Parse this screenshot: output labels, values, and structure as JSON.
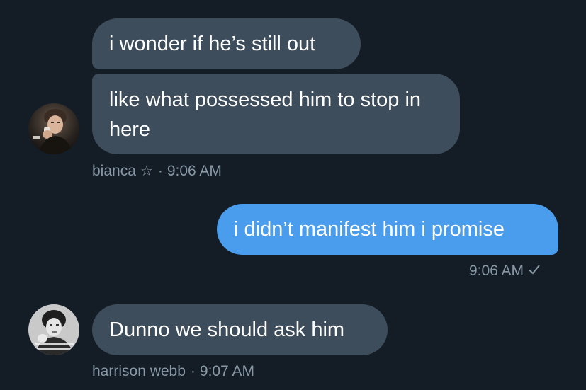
{
  "conversation": {
    "messages": [
      {
        "text": "i wonder if he’s still out"
      },
      {
        "text": "like what possessed him to stop in here"
      },
      {
        "text": "i didn’t manifest him i promise"
      },
      {
        "text": "Dunno we should ask him"
      }
    ],
    "meta": {
      "bianca": {
        "name": "bianca",
        "separator": "·",
        "time": "9:06 AM"
      },
      "self": {
        "time": "9:06 AM"
      },
      "harrison": {
        "name": "harrison webb",
        "separator": "·",
        "time": "9:07 AM"
      }
    }
  },
  "icons": {
    "star": "star-icon",
    "checkmark": "checkmark-icon",
    "avatar1": "user-avatar-photo",
    "avatar2": "user-avatar-photo"
  },
  "colors": {
    "background": "#141d26",
    "incoming_bubble": "#3d4d5c",
    "outgoing_bubble": "#4a9ced",
    "meta_text": "#8899a6"
  }
}
